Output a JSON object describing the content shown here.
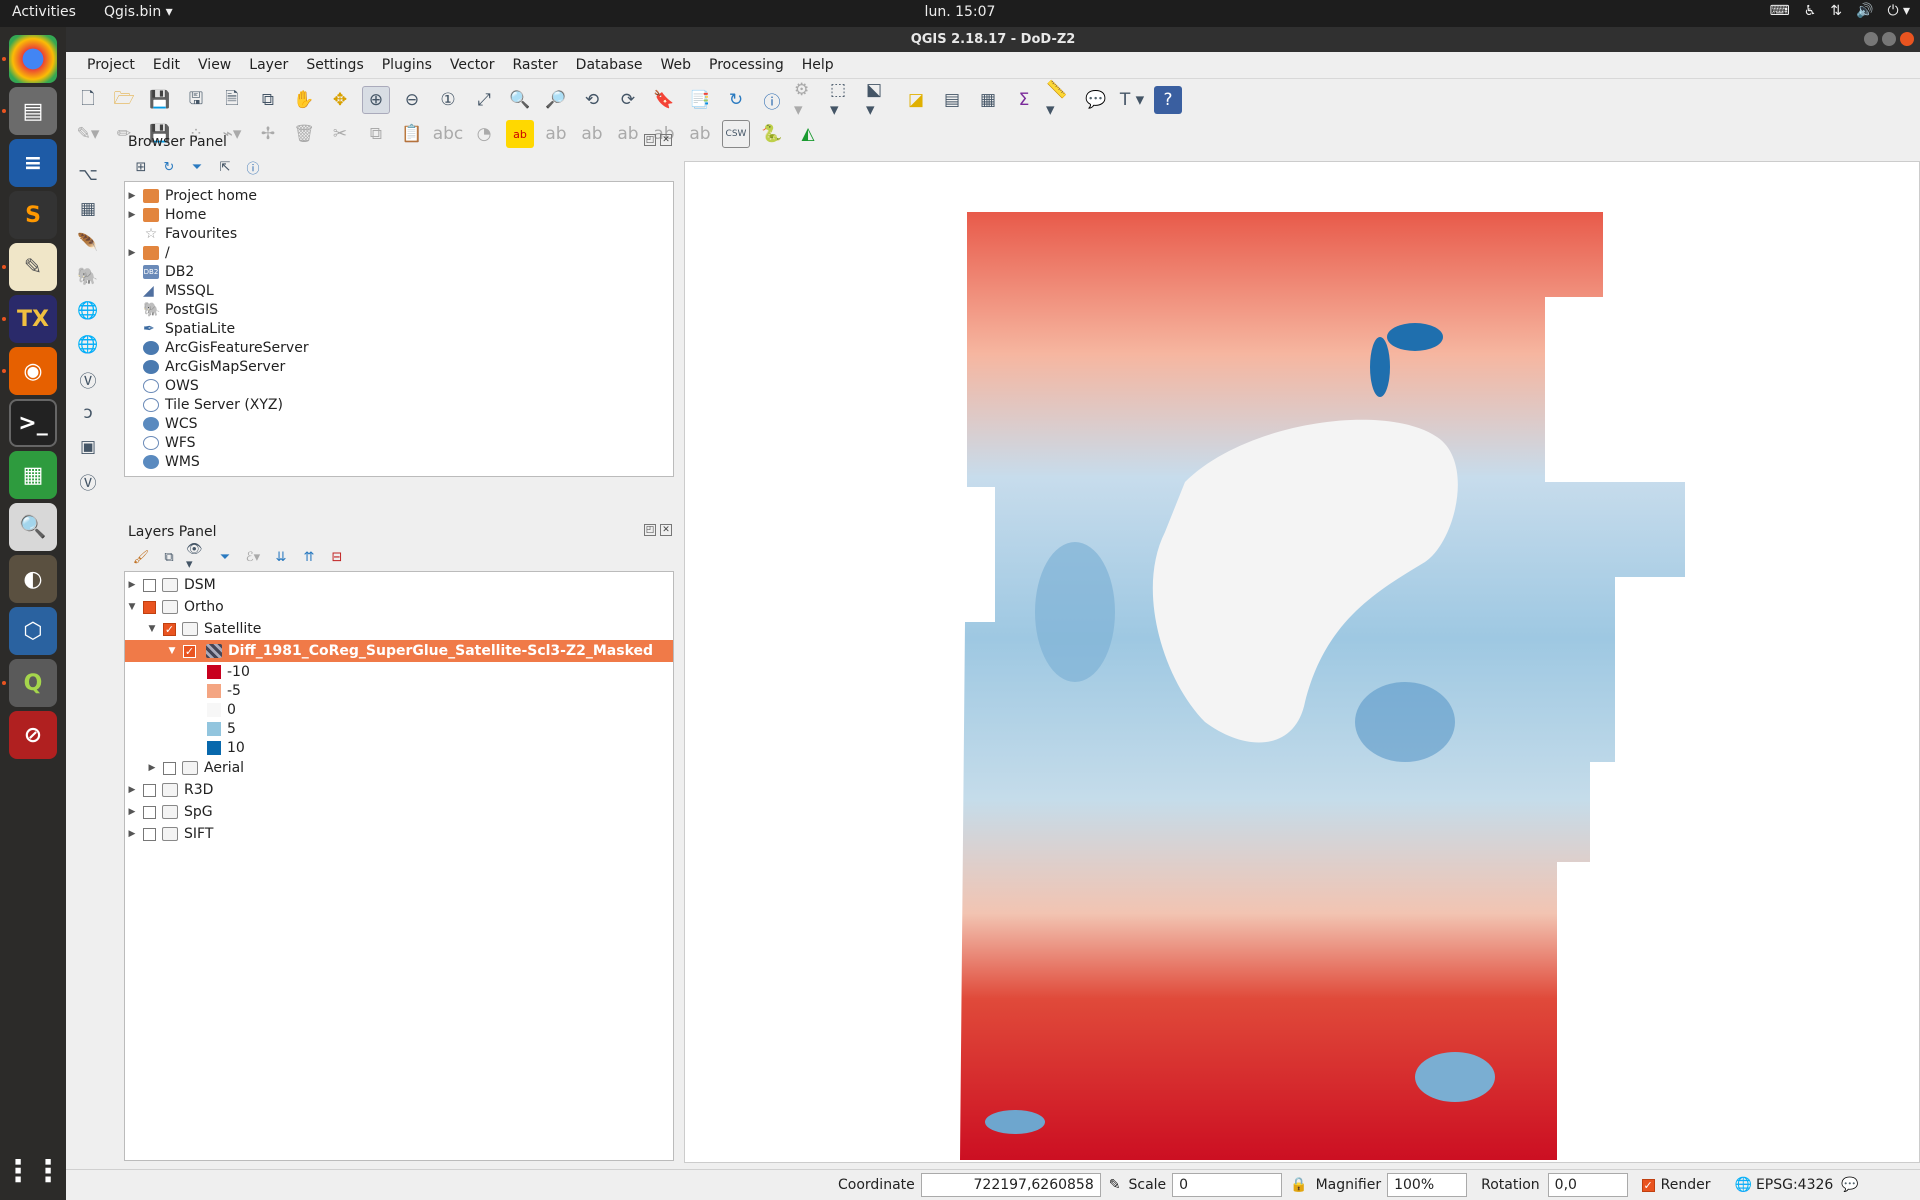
{
  "topbar": {
    "activities": "Activities",
    "app": "Qgis.bin ▾",
    "clock": "lun. 15:07"
  },
  "window": {
    "title": "QGIS 2.18.17 - DoD-Z2"
  },
  "menu": [
    "Project",
    "Edit",
    "View",
    "Layer",
    "Settings",
    "Plugins",
    "Vector",
    "Raster",
    "Database",
    "Web",
    "Processing",
    "Help"
  ],
  "browser": {
    "title": "Browser Panel",
    "items": [
      {
        "label": "Project home",
        "icon": "folder-icon",
        "expandable": true
      },
      {
        "label": "Home",
        "icon": "folder-icon",
        "expandable": true
      },
      {
        "label": "Favourites",
        "icon": "star-icon",
        "expandable": false
      },
      {
        "label": "/",
        "icon": "folder-icon",
        "expandable": true
      },
      {
        "label": "DB2",
        "icon": "db2-icon",
        "expandable": false
      },
      {
        "label": "MSSQL",
        "icon": "mssql-icon",
        "expandable": false
      },
      {
        "label": "PostGIS",
        "icon": "postgis-icon",
        "expandable": false
      },
      {
        "label": "SpatiaLite",
        "icon": "spatialite-icon",
        "expandable": false
      },
      {
        "label": "ArcGisFeatureServer",
        "icon": "arcgis-icon",
        "expandable": false
      },
      {
        "label": "ArcGisMapServer",
        "icon": "arcgis-icon",
        "expandable": false
      },
      {
        "label": "OWS",
        "icon": "globe-icon",
        "expandable": false
      },
      {
        "label": "Tile Server (XYZ)",
        "icon": "globe-icon",
        "expandable": false
      },
      {
        "label": "WCS",
        "icon": "globe-icon",
        "expandable": false
      },
      {
        "label": "WFS",
        "icon": "globe-icon",
        "expandable": false
      },
      {
        "label": "WMS",
        "icon": "globe-icon",
        "expandable": false
      }
    ]
  },
  "layers": {
    "title": "Layers Panel",
    "groups": {
      "dsm": "DSM",
      "ortho": "Ortho",
      "satellite": "Satellite",
      "diff_layer": "Diff_1981_CoReg_SuperGlue_Satellite-Scl3-Z2_Masked",
      "aerial": "Aerial",
      "r3d": "R3D",
      "spg": "SpG",
      "sift": "SIFT"
    },
    "legend": [
      {
        "label": "-10",
        "color": "#c8001e"
      },
      {
        "label": "-5",
        "color": "#f4a582"
      },
      {
        "label": "0",
        "color": "#f7f7f7"
      },
      {
        "label": "5",
        "color": "#92c5de"
      },
      {
        "label": "10",
        "color": "#0868ac"
      }
    ]
  },
  "status": {
    "coordinate_label": "Coordinate",
    "coordinate_value": "722197,6260858",
    "scale_label": "Scale",
    "scale_value": "0",
    "magnifier_label": "Magnifier",
    "magnifier_value": "100%",
    "rotation_label": "Rotation",
    "rotation_value": "0,0",
    "render_label": "Render",
    "crs": "EPSG:4326"
  }
}
